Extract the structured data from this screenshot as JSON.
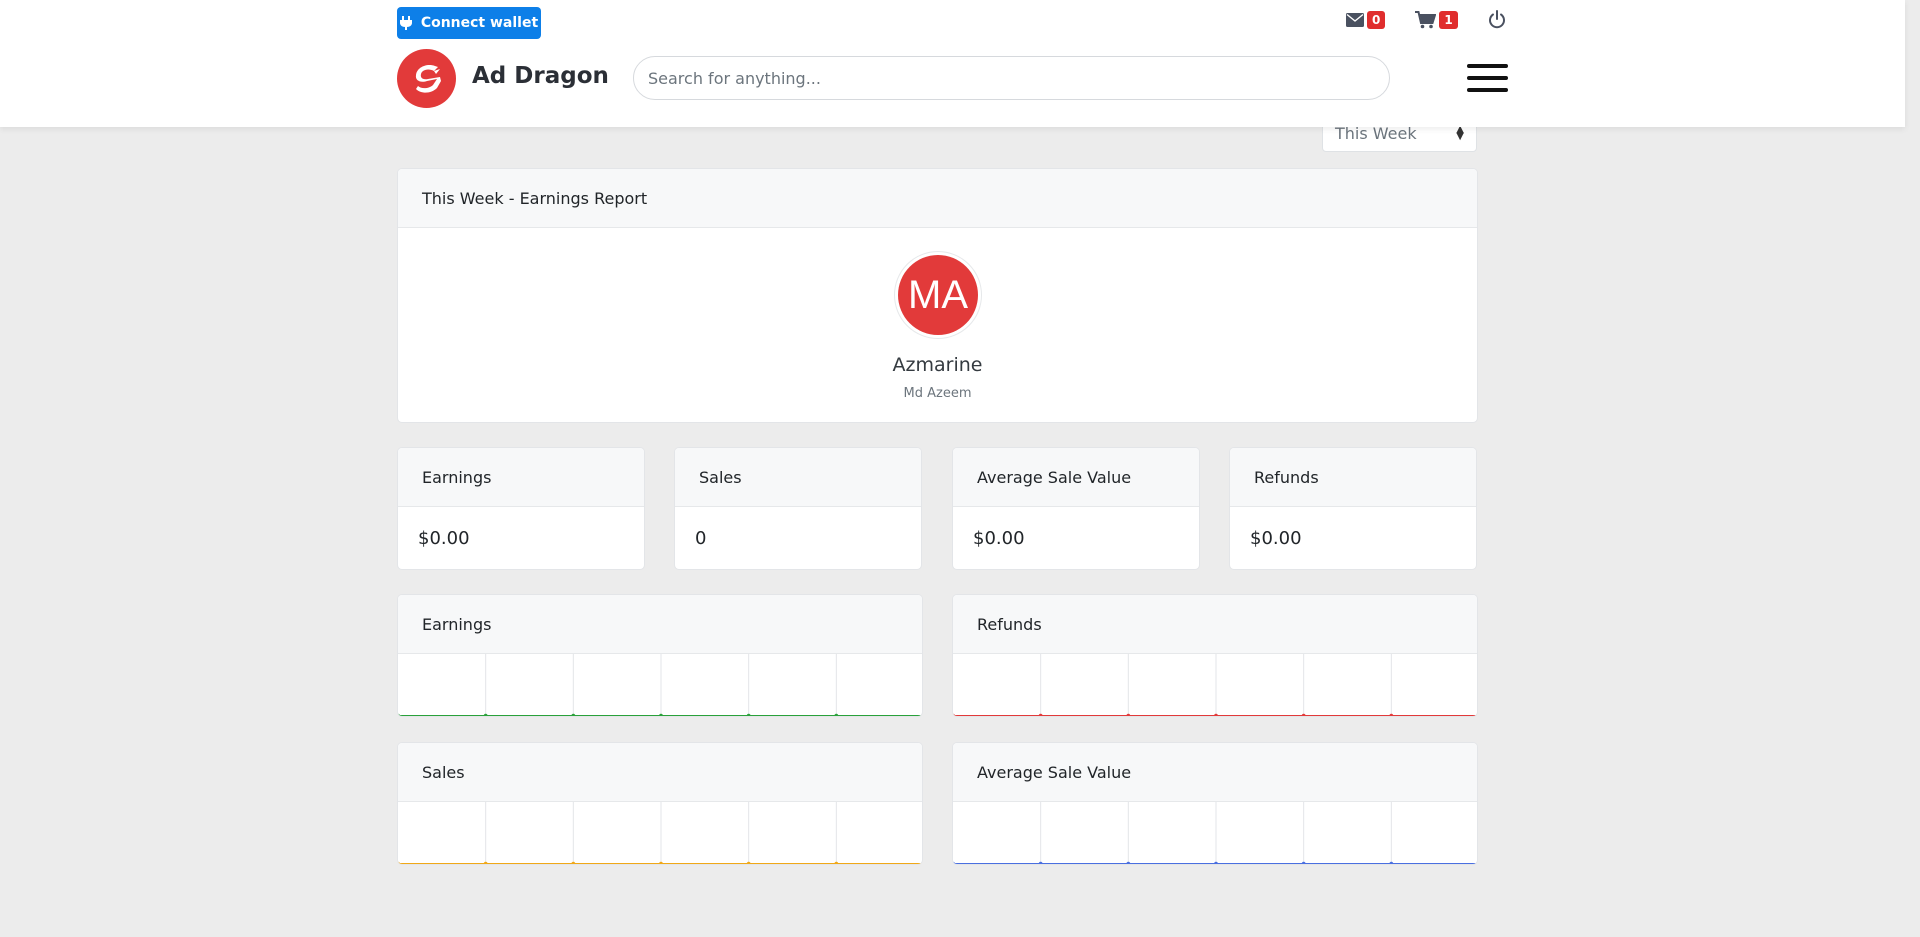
{
  "header": {
    "wallet_label": "Connect wallet",
    "messages_count": "0",
    "cart_count": "1",
    "brand": "Ad Dragon",
    "search_placeholder": "Search for anything..."
  },
  "period": {
    "selected": "This Week"
  },
  "report": {
    "title": "This Week - Earnings Report",
    "avatar_initials": "MA",
    "name": "Azmarine",
    "subtitle": "Md Azeem"
  },
  "stats": [
    {
      "label": "Earnings",
      "value": "$0.00"
    },
    {
      "label": "Sales",
      "value": "0"
    },
    {
      "label": "Average Sale Value",
      "value": "$0.00"
    },
    {
      "label": "Refunds",
      "value": "$0.00"
    }
  ],
  "colors": {
    "brand": "#e23a3a",
    "wallet": "#0d7fe8",
    "earnings": "#2aa13a",
    "refunds": "#e23a3a",
    "sales": "#f0a818",
    "average": "#4a6fe0"
  },
  "chart_data": [
    {
      "type": "line",
      "title": "Earnings",
      "color": "#2aa13a",
      "values": [
        0,
        0,
        0,
        0,
        0,
        0,
        0
      ]
    },
    {
      "type": "line",
      "title": "Refunds",
      "color": "#e23a3a",
      "values": [
        0,
        0,
        0,
        0,
        0,
        0,
        0
      ]
    },
    {
      "type": "line",
      "title": "Sales",
      "color": "#f0a818",
      "values": [
        0,
        0,
        0,
        0,
        0,
        0,
        0
      ]
    },
    {
      "type": "line",
      "title": "Average Sale Value",
      "color": "#4a6fe0",
      "values": [
        0,
        0,
        0,
        0,
        0,
        0,
        0
      ]
    }
  ]
}
